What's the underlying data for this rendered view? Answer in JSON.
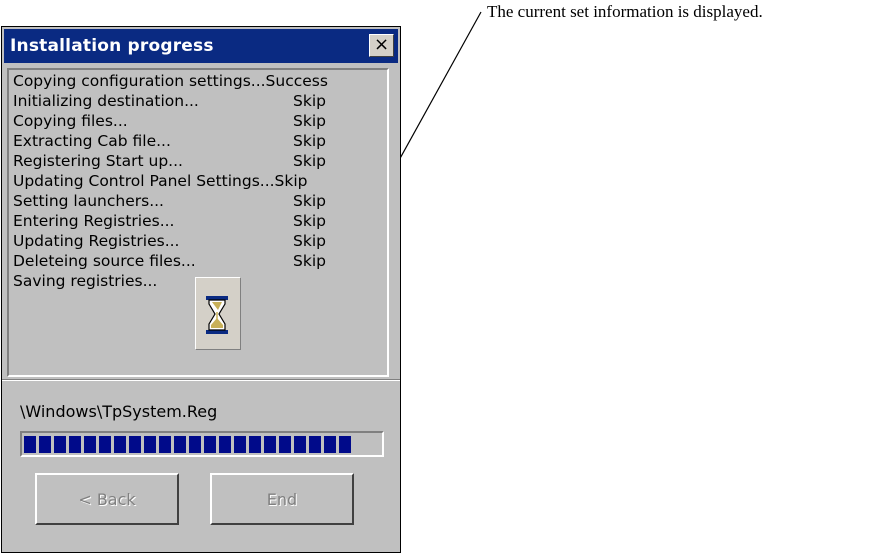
{
  "window": {
    "title": "Installation progress",
    "close_label": "×"
  },
  "log": [
    {
      "text": "Copying configuration settings...Success",
      "status": ""
    },
    {
      "text": "Initializing destination...",
      "status": "Skip"
    },
    {
      "text": "Copying files...",
      "status": "Skip"
    },
    {
      "text": "Extracting Cab file...",
      "status": "Skip"
    },
    {
      "text": "Registering Start up...",
      "status": "Skip"
    },
    {
      "text": "Updating Control Panel Settings...Skip",
      "status": ""
    },
    {
      "text": "Setting launchers...",
      "status": "Skip"
    },
    {
      "text": "Entering Registries...",
      "status": "Skip"
    },
    {
      "text": "Updating Registries...",
      "status": "Skip"
    },
    {
      "text": "Deleteing source files...",
      "status": "Skip"
    },
    {
      "text": "Saving registries...",
      "status": ""
    }
  ],
  "current_file": "\\Windows\\TpSystem.Reg",
  "progress": {
    "fraction": 0.92
  },
  "buttons": {
    "back": "< Back",
    "end": "End"
  },
  "annotation": "The current set information is displayed.",
  "colors": {
    "titlebar": "#0a2a82",
    "progress": "#000a8a",
    "window": "#c0c0c0"
  },
  "icons": {
    "busy": "hourglass-icon",
    "close": "close-icon"
  }
}
